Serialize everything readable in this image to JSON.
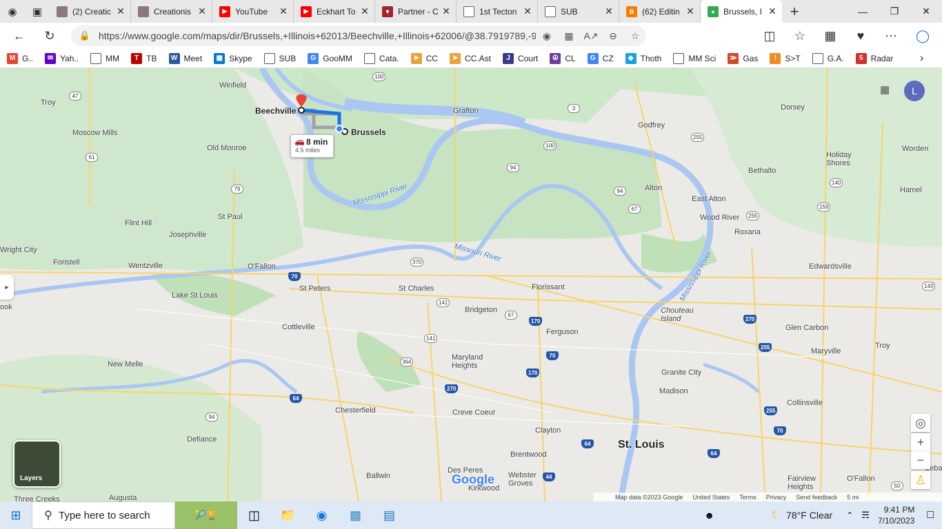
{
  "tabs": [
    {
      "label": "(2) Creatic",
      "icon": "page-icon",
      "color": "#8a7a7a"
    },
    {
      "label": "Creationis",
      "icon": "page-icon",
      "color": "#8a7a7a"
    },
    {
      "label": "YouTube",
      "icon": "youtube-icon",
      "color": "#ff0000"
    },
    {
      "label": "Eckhart To",
      "icon": "youtube-icon",
      "color": "#ff0000"
    },
    {
      "label": "Partner - C",
      "icon": "fox-icon",
      "color": "#a4262c"
    },
    {
      "label": "1st Tecton",
      "icon": "document-icon",
      "color": "#666666"
    },
    {
      "label": "SUB",
      "icon": "document-icon",
      "color": "#666666"
    },
    {
      "label": "(62) Editin",
      "icon": "blogger-icon",
      "color": "#f57d00"
    },
    {
      "label": "Brussels, I",
      "icon": "maps-icon",
      "color": "#34a853"
    }
  ],
  "address": {
    "url": "https://www.google.com/maps/dir/Brussels,+Illinois+62013/Beechville,+Illinois+62006/@38.7919789,-90.4241939,10...."
  },
  "favorites": [
    {
      "label": "G..",
      "icon": "gmail-icon",
      "color": "#ea4335"
    },
    {
      "label": "Yah..",
      "icon": "yahoo-icon",
      "color": "#6001d2"
    },
    {
      "label": "MM",
      "icon": "page-icon",
      "color": "#555555"
    },
    {
      "label": "TB",
      "icon": "tb-icon",
      "color": "#c00000"
    },
    {
      "label": "Meet",
      "icon": "w-icon",
      "color": "#2b579a"
    },
    {
      "label": "Skype",
      "icon": "windows-icon",
      "color": "#0078d4"
    },
    {
      "label": "SUB",
      "icon": "page-icon",
      "color": "#555555"
    },
    {
      "label": "GooMM",
      "icon": "google-icon",
      "color": "#4285f4"
    },
    {
      "label": "Cata.",
      "icon": "page-icon",
      "color": "#555555"
    },
    {
      "label": "CC",
      "icon": "arrow-icon",
      "color": "#e8a33d"
    },
    {
      "label": "CC.Ast",
      "icon": "arrow-icon",
      "color": "#e8a33d"
    },
    {
      "label": "Court",
      "icon": "court-icon",
      "color": "#3a3a8c"
    },
    {
      "label": "CL",
      "icon": "peace-icon",
      "color": "#6a3d9a"
    },
    {
      "label": "CZ",
      "icon": "google-icon",
      "color": "#4285f4"
    },
    {
      "label": "Thoth",
      "icon": "thoth-icon",
      "color": "#1ba1e2"
    },
    {
      "label": "MM Sci",
      "icon": "page-icon",
      "color": "#555555"
    },
    {
      "label": "Gas",
      "icon": "gas-icon",
      "color": "#d2462d"
    },
    {
      "label": "S>T",
      "icon": "st-icon",
      "color": "#f08a24"
    },
    {
      "label": "G.A.",
      "icon": "page-icon",
      "color": "#555555"
    },
    {
      "label": "Radar",
      "icon": "radar-icon",
      "color": "#d32f2f"
    }
  ],
  "map": {
    "labels": {
      "winfield": "Winfield",
      "troy_mo": "Troy",
      "moscow_mills": "Moscow Mills",
      "old_monroe": "Old Monroe",
      "flint_hill": "Flint Hill",
      "josephville": "Josephville",
      "st_paul": "St Paul",
      "wright_city": "Wright City",
      "foristell": "Foristell",
      "wentzville": "Wentzville",
      "ofallon_mo": "O'Fallon",
      "lake_st_louis": "Lake St Louis",
      "st_peters": "St Peters",
      "st_charles": "St Charles",
      "cottleville": "Cottleville",
      "new_melle": "New Melle",
      "defiance": "Defiance",
      "augusta": "Augusta",
      "three_creeks": "Three Creeks",
      "chesterfield": "Chesterfield",
      "ballwin": "Ballwin",
      "des_peres": "Des Peres",
      "kirkwood": "Kirkwood",
      "grafton": "Grafton",
      "dorsey": "Dorsey",
      "godfrey": "Godfrey",
      "worden": "Worden",
      "holiday_shores": "Holiday\nShores",
      "bethalto": "Bethalto",
      "alton": "Alton",
      "east_alton": "East Alton",
      "hamel": "Hamel",
      "wood_river": "Wood River",
      "roxana": "Roxana",
      "edwardsville": "Edwardsville",
      "florissant": "Florissant",
      "bridgeton": "Bridgeton",
      "ferguson": "Ferguson",
      "chouteau": "Chouteau\nIsland",
      "glen_carbon": "Glen Carbon",
      "troy_il": "Troy",
      "maryville": "Maryville",
      "maryland_heights": "Maryland\nHeights",
      "creve_coeur": "Creve Coeur",
      "granite_city": "Granite City",
      "madison": "Madison",
      "collinsville": "Collinsville",
      "clayton": "Clayton",
      "brentwood": "Brentwood",
      "st_louis": "St. Louis",
      "webster_groves": "Webster\nGroves",
      "fairview_heights": "Fairview\nHeights",
      "ofallon_il": "O'Fallon",
      "book": "ook",
      "lebanon": "Leba",
      "mississippi_river_1": "Mississippi River",
      "missouri_river": "Missouri River",
      "mississippi_river_2": "Mississippi River"
    },
    "shields": {
      "s100a": "100",
      "s100b": "100",
      "s3": "3",
      "s47": "47",
      "s61": "61",
      "s79": "79",
      "s94a": "94",
      "s94b": "94",
      "s94c": "94",
      "s67a": "67",
      "s67b": "67",
      "s255a": "255",
      "s255b": "255",
      "s140": "140",
      "s159": "159",
      "s143": "143",
      "s370": "370",
      "s141a": "141",
      "s141b": "141",
      "s364": "364",
      "s50": "50",
      "i70a": "70",
      "i70b": "70",
      "i70c": "70",
      "i170a": "170",
      "i170b": "170",
      "i270a": "270",
      "i270b": "270",
      "i255a": "255",
      "i255b": "255",
      "i64a": "64",
      "i64b": "64",
      "i64c": "64",
      "i44": "44"
    },
    "route": {
      "origin": "Brussels",
      "destination": "Beechville",
      "time": "8 min",
      "distance": "4.5 miles"
    },
    "layers_label": "Layers",
    "profile_initial": "L",
    "google_logo": "Google",
    "footer": {
      "mapdata": "Map data ©2023 Google",
      "country": "United States",
      "terms": "Terms",
      "privacy": "Privacy",
      "feedback": "Send feedback",
      "scale": "5 mi"
    }
  },
  "taskbar": {
    "search_placeholder": "Type here to search",
    "weather": "78°F  Clear",
    "time": "9:41 PM",
    "date": "7/10/2023"
  }
}
